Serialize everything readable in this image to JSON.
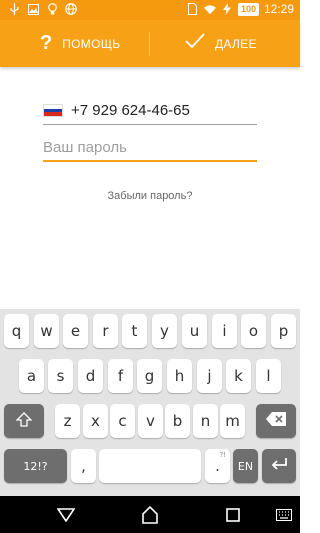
{
  "status_bar": {
    "icons": [
      "usb-icon",
      "image-icon",
      "bulb-icon",
      "globe-icon"
    ],
    "right_icons": [
      "sim-icon",
      "wifi-icon",
      "charging-icon"
    ],
    "battery": "100",
    "time": "12:29"
  },
  "action_bar": {
    "help_label": "ПОМОЩЬ",
    "next_label": "ДАЛЕЕ",
    "color": "#f7a216"
  },
  "form": {
    "country_flag": "russia-flag-icon",
    "phone": "+7 929 624-46-65",
    "password_placeholder": "Ваш пароль",
    "forgot_password": "Забыли пароль?",
    "accent_color": "#f5a114"
  },
  "keyboard": {
    "row1": [
      "q",
      "w",
      "e",
      "r",
      "t",
      "y",
      "u",
      "i",
      "o",
      "p"
    ],
    "row2": [
      "a",
      "s",
      "d",
      "f",
      "g",
      "h",
      "j",
      "k",
      "l"
    ],
    "row3": [
      "z",
      "x",
      "c",
      "v",
      "b",
      "n",
      "m"
    ],
    "symbols_key": "12!?",
    "comma_key": ",",
    "period_key": ".",
    "period_sub": "?!",
    "lang_key": "EN"
  },
  "nav_bar": {
    "buttons": [
      "back-icon",
      "home-icon",
      "recents-icon",
      "keyboard-icon"
    ]
  }
}
